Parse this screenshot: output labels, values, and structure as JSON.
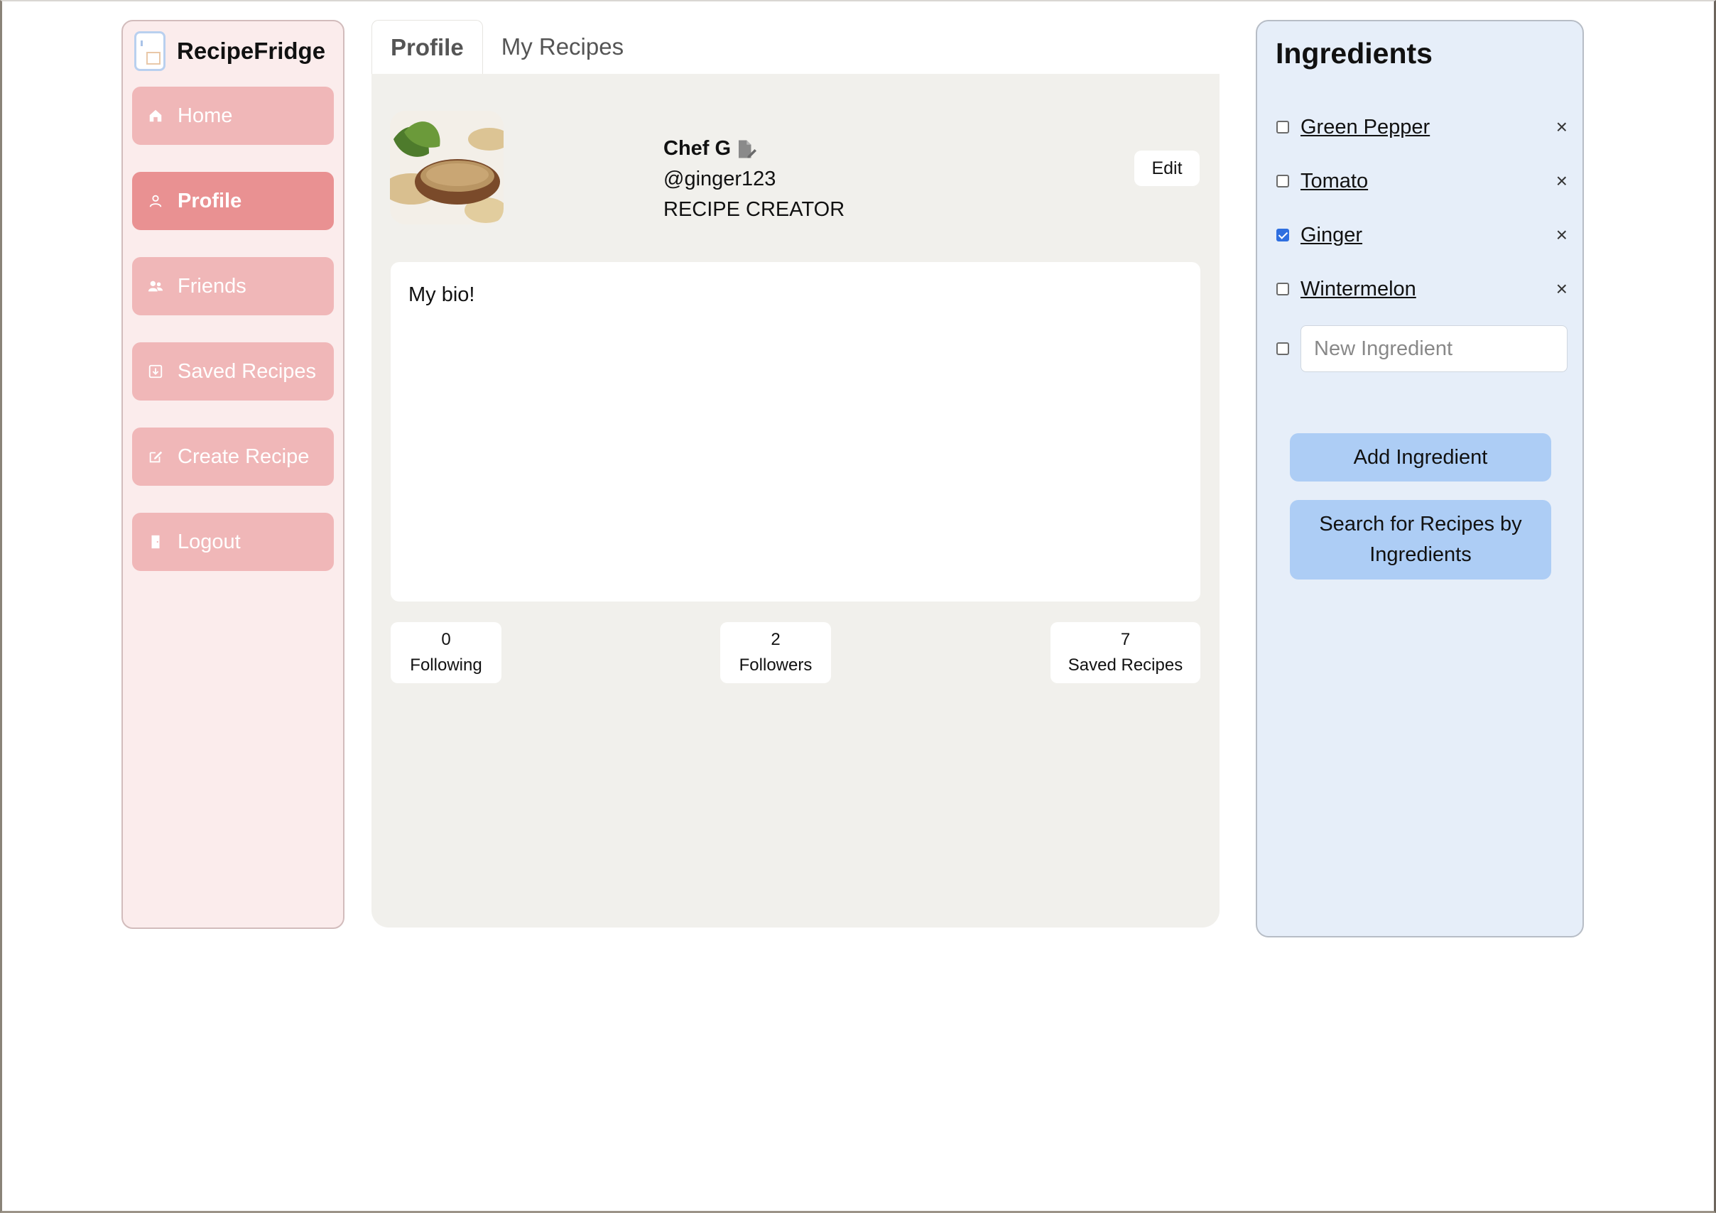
{
  "app": {
    "name": "RecipeFridge"
  },
  "sidebar": {
    "items": [
      {
        "label": "Home",
        "icon": "home-icon"
      },
      {
        "label": "Profile",
        "icon": "user-icon",
        "active": true
      },
      {
        "label": "Friends",
        "icon": "users-icon"
      },
      {
        "label": "Saved Recipes",
        "icon": "save-icon"
      },
      {
        "label": "Create Recipe",
        "icon": "edit-icon"
      },
      {
        "label": "Logout",
        "icon": "door-icon"
      }
    ]
  },
  "tabs": [
    {
      "label": "Profile",
      "active": true
    },
    {
      "label": "My Recipes",
      "active": false
    }
  ],
  "profile": {
    "display_name": "Chef G",
    "username": "@ginger123",
    "role": "RECIPE CREATOR",
    "edit_label": "Edit",
    "bio": "My bio!",
    "stats": {
      "following": {
        "value": "0",
        "label": "Following"
      },
      "followers": {
        "value": "2",
        "label": "Followers"
      },
      "saved": {
        "value": "7",
        "label": "Saved Recipes"
      }
    }
  },
  "ingredients": {
    "title": "Ingredients",
    "items": [
      {
        "name": "Green Pepper",
        "checked": false
      },
      {
        "name": "Tomato",
        "checked": false
      },
      {
        "name": "Ginger",
        "checked": true
      },
      {
        "name": "Wintermelon",
        "checked": false
      }
    ],
    "remove_symbol": "×",
    "new_placeholder": "New Ingredient",
    "add_label": "Add Ingredient",
    "search_label": "Search for Recipes by Ingredients"
  },
  "colors": {
    "sidebar_bg": "#fbecec",
    "nav_item": "#f0b7b8",
    "nav_active": "#e99192",
    "main_bg": "#f1f0ec",
    "ingredients_bg": "#e6eef9",
    "button_blue": "#adcdf5",
    "checkbox_checked": "#2f6fe0"
  }
}
